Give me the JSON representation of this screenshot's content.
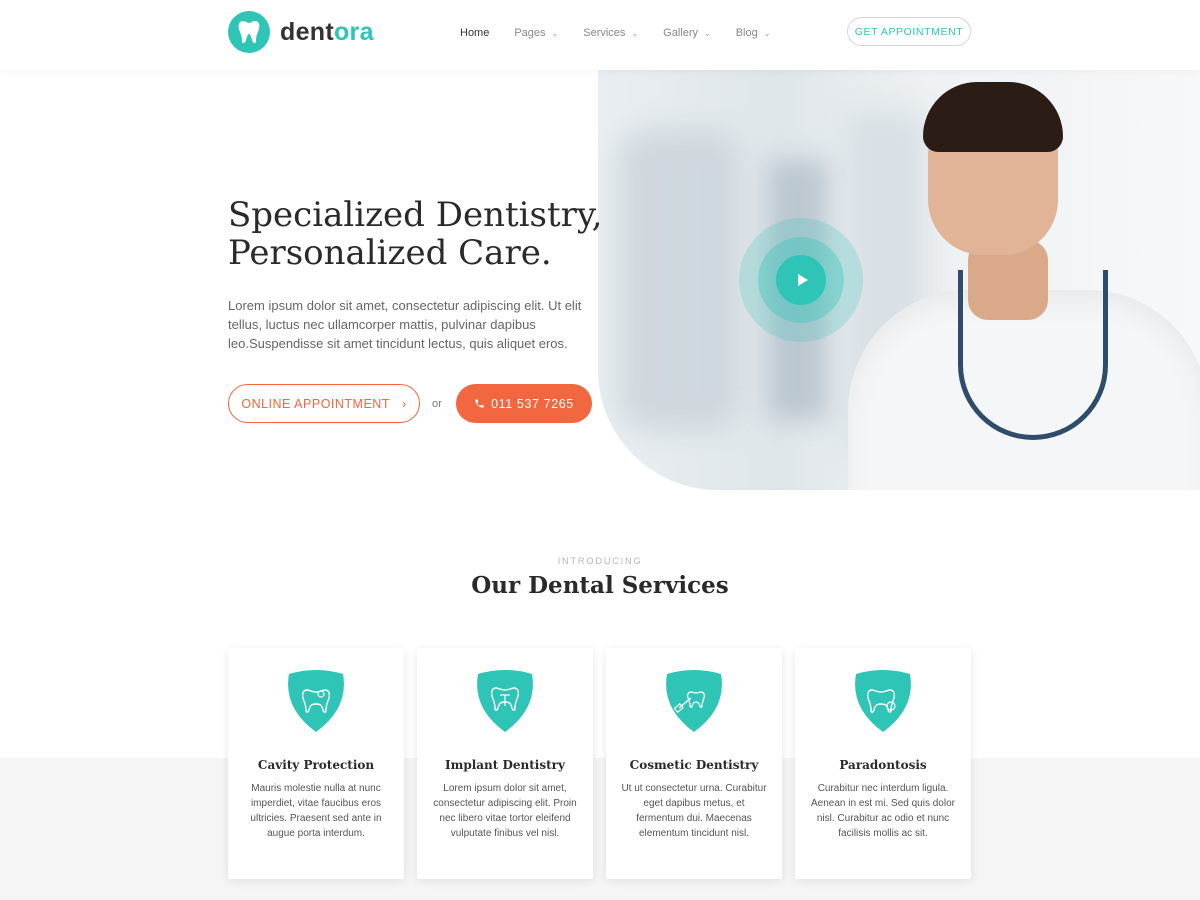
{
  "brand": {
    "name_part1": "dent",
    "name_part2": "ora",
    "primary_color": "#2ec4b6",
    "accent_color": "#f26640"
  },
  "nav": {
    "items": [
      {
        "label": "Home",
        "has_dropdown": false,
        "active": true
      },
      {
        "label": "Pages",
        "has_dropdown": true
      },
      {
        "label": "Services",
        "has_dropdown": true
      },
      {
        "label": "Gallery",
        "has_dropdown": true
      },
      {
        "label": "Blog",
        "has_dropdown": true
      }
    ],
    "cta_label": "GET APPOINTMENT"
  },
  "hero": {
    "title_line1": "Specialized Dentistry,",
    "title_line2": "Personalized Care.",
    "text": "Lorem ipsum dolor sit amet, consectetur adipiscing elit. Ut elit tellus, luctus nec ullamcorper mattis, pulvinar dapibus leo.Suspendisse sit amet tincidunt lectus, quis aliquet eros.",
    "appointment_label": "ONLINE APPOINTMENT",
    "or_label": "or",
    "phone": "011 537 7265"
  },
  "services": {
    "eyebrow": "INTRODUCING",
    "title": "Our Dental Services",
    "cards": [
      {
        "icon": "tooth-cavity-icon",
        "title": "Cavity Protection",
        "text": "Mauris molestie nulla at nunc imperdiet, vitae faucibus eros ultricies. Praesent sed ante in augue porta interdum."
      },
      {
        "icon": "tooth-implant-icon",
        "title": "Implant Dentistry",
        "text": "Lorem ipsum dolor sit amet, consectetur adipiscing elit. Proin nec libero vitae tortor eleifend vulputate finibus vel nisl."
      },
      {
        "icon": "tooth-brush-icon",
        "title": "Cosmetic Dentistry",
        "text": "Ut ut consectetur urna. Curabitur eget dapibus metus, et fermentum dui. Maecenas elementum tincidunt nisl."
      },
      {
        "icon": "tooth-paradontosis-icon",
        "title": "Paradontosis",
        "text": "Curabitur nec interdum ligula. Aenean in est mi. Sed quis dolor nisl. Curabitur ac odio et nunc facilisis mollis ac sit."
      }
    ]
  }
}
